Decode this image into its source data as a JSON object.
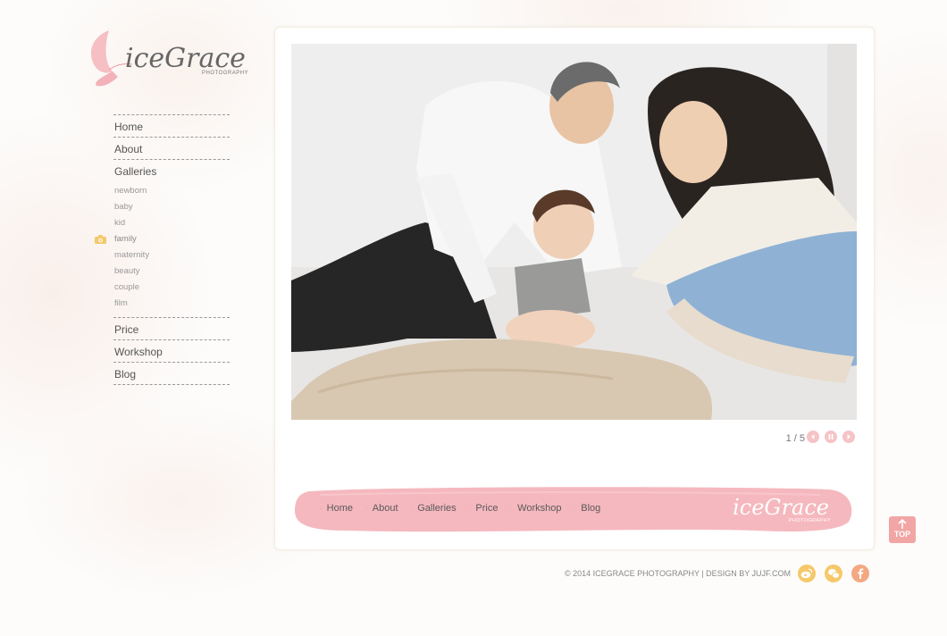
{
  "brand": {
    "name": "iceGrace",
    "tagline": "PHOTOGRAPHY",
    "colors": {
      "pink": "#f4b8be",
      "accent": "#f2a5a5",
      "social_gold": "#f5c86a",
      "social_orange": "#f3a882"
    }
  },
  "sidebar": {
    "main_before": [
      {
        "label": "Home"
      },
      {
        "label": "About"
      },
      {
        "label": "Galleries"
      }
    ],
    "sub_items": [
      {
        "label": "newborn"
      },
      {
        "label": "baby"
      },
      {
        "label": "kid"
      },
      {
        "label": "family",
        "active": true,
        "icon": "camera-icon"
      },
      {
        "label": "maternity"
      },
      {
        "label": "beauty"
      },
      {
        "label": "couple"
      },
      {
        "label": "film"
      }
    ],
    "main_after": [
      {
        "label": "Price"
      },
      {
        "label": "Workshop"
      },
      {
        "label": "Blog"
      }
    ]
  },
  "slideshow": {
    "counter": "1 / 5",
    "controls": [
      "prev-icon",
      "pause-icon",
      "next-icon"
    ]
  },
  "footer_nav": {
    "items": [
      "Home",
      "About",
      "Galleries",
      "Price",
      "Workshop",
      "Blog"
    ],
    "logo": "iceGrace",
    "logo_sub": "PHOTOGRAPHY"
  },
  "top_button": {
    "label": "TOP"
  },
  "copyright": "© 2014 ICEGRACE PHOTOGRAPHY | DESIGN BY JUJF.COM",
  "social": [
    "weibo-icon",
    "wechat-icon",
    "facebook-icon"
  ]
}
